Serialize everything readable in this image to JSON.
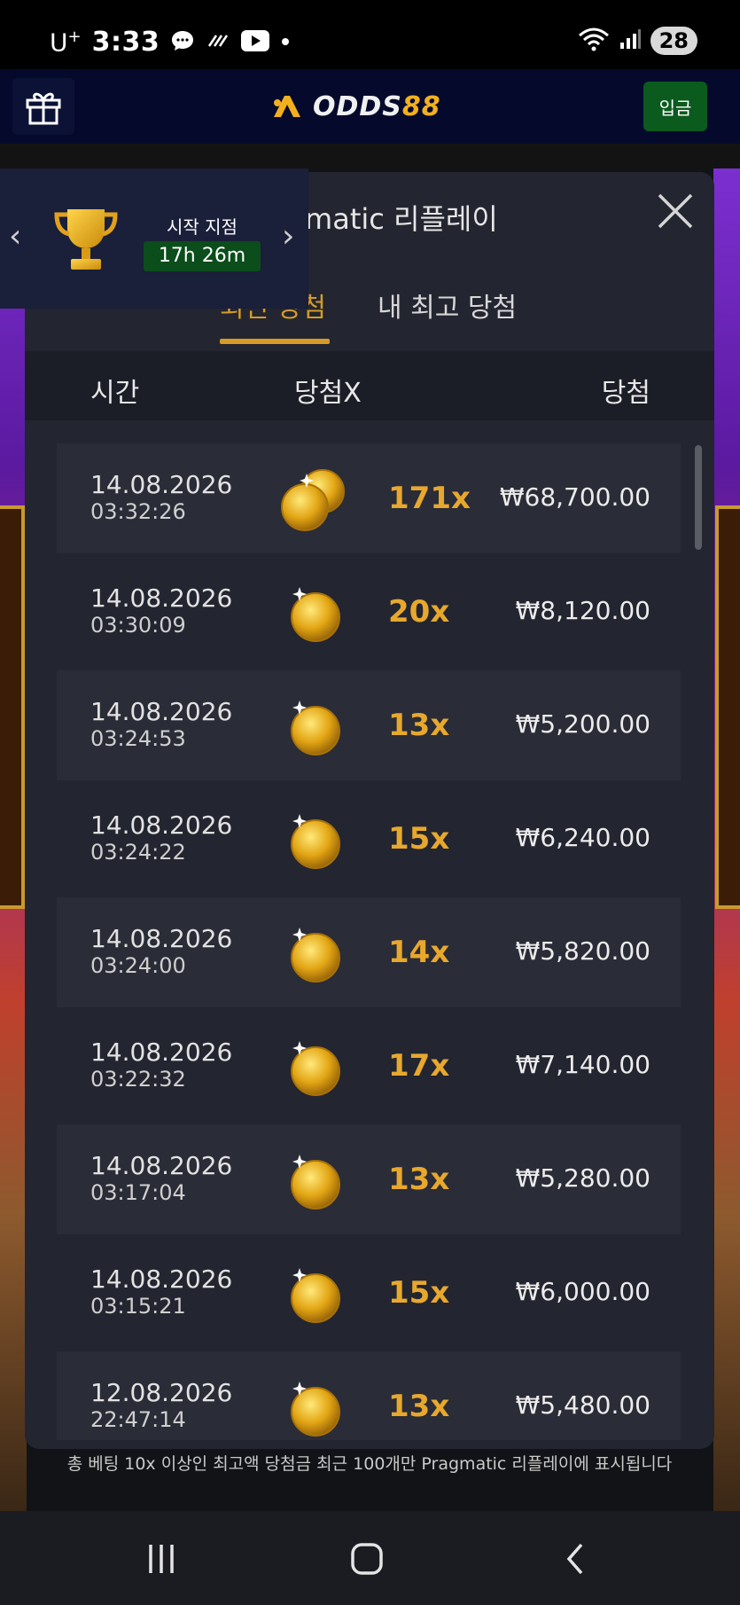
{
  "status_bar": {
    "carrier": "U",
    "carrier_sup": "+",
    "time": "3:33",
    "battery": "28",
    "icons": [
      "chat-icon",
      "signal-slash-icon",
      "youtube-icon",
      "dot-icon",
      "wifi-icon",
      "cell-signal-icon"
    ]
  },
  "header": {
    "logo_white": "ODDS",
    "logo_yellow": "88",
    "deposit_label": "입금",
    "accent_color": "#f2b01e",
    "deposit_color": "#0b5a1e"
  },
  "tournament": {
    "label": "시작 지점",
    "timer": "17h 26m"
  },
  "modal": {
    "title": "Pragmatic 리플레이",
    "tabs": [
      {
        "label": "최신 당첨",
        "active": true
      },
      {
        "label": "내 최고 당첨",
        "active": false
      }
    ],
    "columns": {
      "time": "시간",
      "multiplier": "당첨X",
      "win": "당첨"
    },
    "rows": [
      {
        "date": "14.08.2026",
        "time": "03:32:26",
        "multiplier": "171x",
        "amount": "₩68,700.00",
        "coins": 2
      },
      {
        "date": "14.08.2026",
        "time": "03:30:09",
        "multiplier": "20x",
        "amount": "₩8,120.00",
        "coins": 1
      },
      {
        "date": "14.08.2026",
        "time": "03:24:53",
        "multiplier": "13x",
        "amount": "₩5,200.00",
        "coins": 1
      },
      {
        "date": "14.08.2026",
        "time": "03:24:22",
        "multiplier": "15x",
        "amount": "₩6,240.00",
        "coins": 1
      },
      {
        "date": "14.08.2026",
        "time": "03:24:00",
        "multiplier": "14x",
        "amount": "₩5,820.00",
        "coins": 1
      },
      {
        "date": "14.08.2026",
        "time": "03:22:32",
        "multiplier": "17x",
        "amount": "₩7,140.00",
        "coins": 1
      },
      {
        "date": "14.08.2026",
        "time": "03:17:04",
        "multiplier": "13x",
        "amount": "₩5,280.00",
        "coins": 1
      },
      {
        "date": "14.08.2026",
        "time": "03:15:21",
        "multiplier": "15x",
        "amount": "₩6,000.00",
        "coins": 1
      },
      {
        "date": "12.08.2026",
        "time": "22:47:14",
        "multiplier": "13x",
        "amount": "₩5,480.00",
        "coins": 1
      }
    ],
    "footnote": "총 베팅 10x 이상인 최고액 당첨금 최근 100개만 Pragmatic 리플레이에 표시됩니다",
    "multiplier_color": "#e7a82d"
  },
  "nav_bar": {
    "buttons": [
      "recent-apps-icon",
      "home-icon",
      "back-icon"
    ]
  }
}
